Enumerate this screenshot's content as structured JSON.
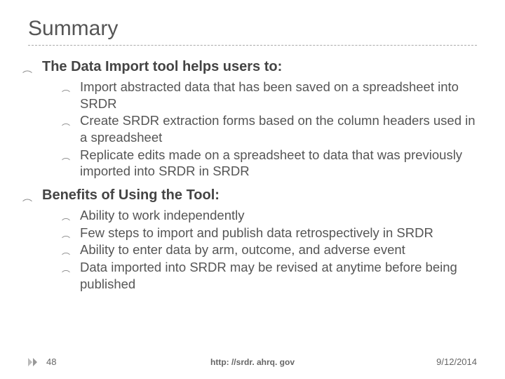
{
  "title": "Summary",
  "sections": [
    {
      "heading": "The Data Import tool helps users to:",
      "items": [
        "Import abstracted data that has been saved on a spreadsheet into SRDR",
        "Create SRDR extraction forms based on the column headers used in a spreadsheet",
        "Replicate edits made on a spreadsheet to data that was previously imported into SRDR in SRDR"
      ]
    },
    {
      "heading": "Benefits of Using the Tool:",
      "items": [
        "Ability to work independently",
        "Few steps to import and publish data retrospectively in SRDR",
        "Ability to enter data by arm, outcome, and adverse event",
        "Data imported into SRDR may be revised at anytime before being published"
      ]
    }
  ],
  "footer": {
    "page": "48",
    "link": "http: //srdr. ahrq. gov",
    "date": "9/12/2014"
  }
}
